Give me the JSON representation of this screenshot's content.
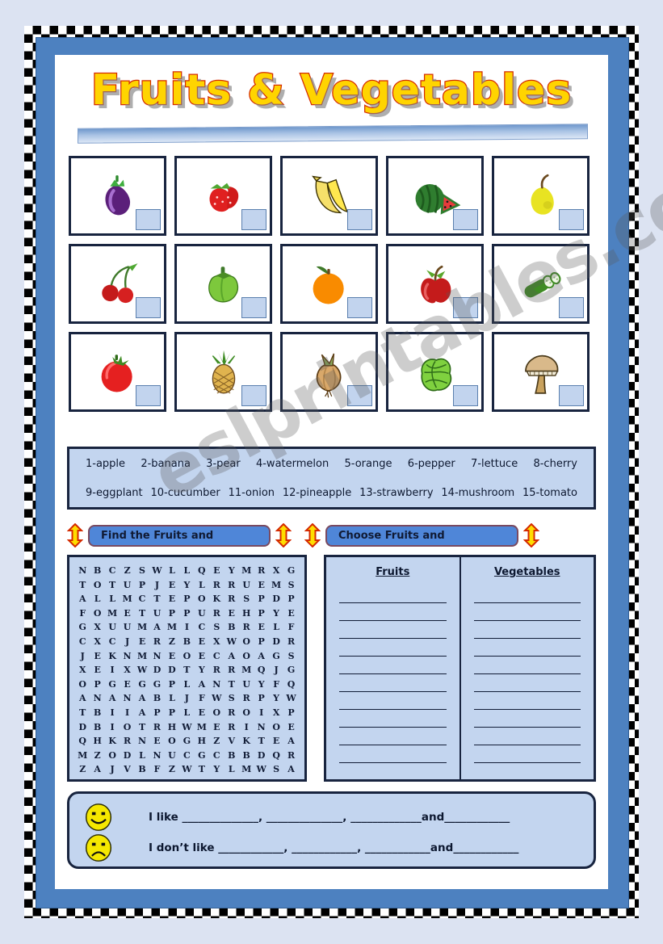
{
  "worksheet": {
    "title": "Fruits & Vegetables",
    "watermark": "eslprintables.com"
  },
  "pictures": [
    {
      "name": "eggplant",
      "answer": ""
    },
    {
      "name": "strawberry",
      "answer": ""
    },
    {
      "name": "banana",
      "answer": ""
    },
    {
      "name": "watermelon",
      "answer": ""
    },
    {
      "name": "pear",
      "answer": ""
    },
    {
      "name": "cherry",
      "answer": ""
    },
    {
      "name": "pepper",
      "answer": ""
    },
    {
      "name": "orange",
      "answer": ""
    },
    {
      "name": "apple",
      "answer": ""
    },
    {
      "name": "cucumber",
      "answer": ""
    },
    {
      "name": "tomato",
      "answer": ""
    },
    {
      "name": "pineapple",
      "answer": ""
    },
    {
      "name": "onion",
      "answer": ""
    },
    {
      "name": "lettuce",
      "answer": ""
    },
    {
      "name": "mushroom",
      "answer": ""
    }
  ],
  "word_bank": {
    "row1": [
      "1-apple",
      "2-banana",
      "3-pear",
      "4-watermelon",
      "5-orange",
      "6-pepper",
      "7-lettuce",
      "8-cherry"
    ],
    "row2": [
      "9-eggplant",
      "10-cucumber",
      "11-onion",
      "12-pineapple",
      "13-strawberry",
      "14-mushroom",
      "15-tomato"
    ]
  },
  "instructions": {
    "left_label": "Find the Fruits and",
    "right_label": "Choose Fruits and"
  },
  "word_search": {
    "rows": [
      "NBCZSWLLQEYMRXG",
      "TOTUPJEYLRRUEMS",
      "ALLMCTEPOKRSPDP",
      "FOMETUPPUREHPYE",
      "GXUUMAMICSBRELF",
      "CXCJERZBEXWOPDR",
      "JEKNMNEOECAOAGS",
      "XEIXWDDTYRRMQJG",
      "OPGEGGPLANTUYFQ",
      "ANANABLJFWSRPYW",
      "TBIIAPPLEOROIXP",
      "DBIOTRHWMERINOE",
      "QHKRNEOGHZVKTEA",
      "MZODLNUCGCBBDQR",
      "ZAJVBFZWTYLMWSA"
    ]
  },
  "sorting": {
    "fruits_header": "Fruits",
    "vegetables_header": "Vegetables",
    "fruits_entries": [
      "",
      "",
      "",
      "",
      "",
      "",
      "",
      "",
      "",
      ""
    ],
    "vegetables_entries": [
      "",
      "",
      "",
      "",
      "",
      "",
      "",
      "",
      "",
      ""
    ]
  },
  "likes": {
    "like_text": "I like ______________, ______________, _____________and____________",
    "dislike_text": "I don’t like ____________, ____________, ____________and____________",
    "happy_face": "happy-face-icon",
    "sad_face": "sad-face-icon"
  },
  "colors": {
    "page_background": "#dce3f2",
    "frame_blue": "#4d81c0",
    "panel_blue": "#c3d5ef",
    "border_navy": "#18243f",
    "title_fill": "#ffd400",
    "title_outline": "#d42a00",
    "button_blue": "#4f86d8",
    "arrow_yellow": "#ffdd00",
    "arrow_outline": "#d42a00",
    "face_yellow": "#f5e800"
  }
}
